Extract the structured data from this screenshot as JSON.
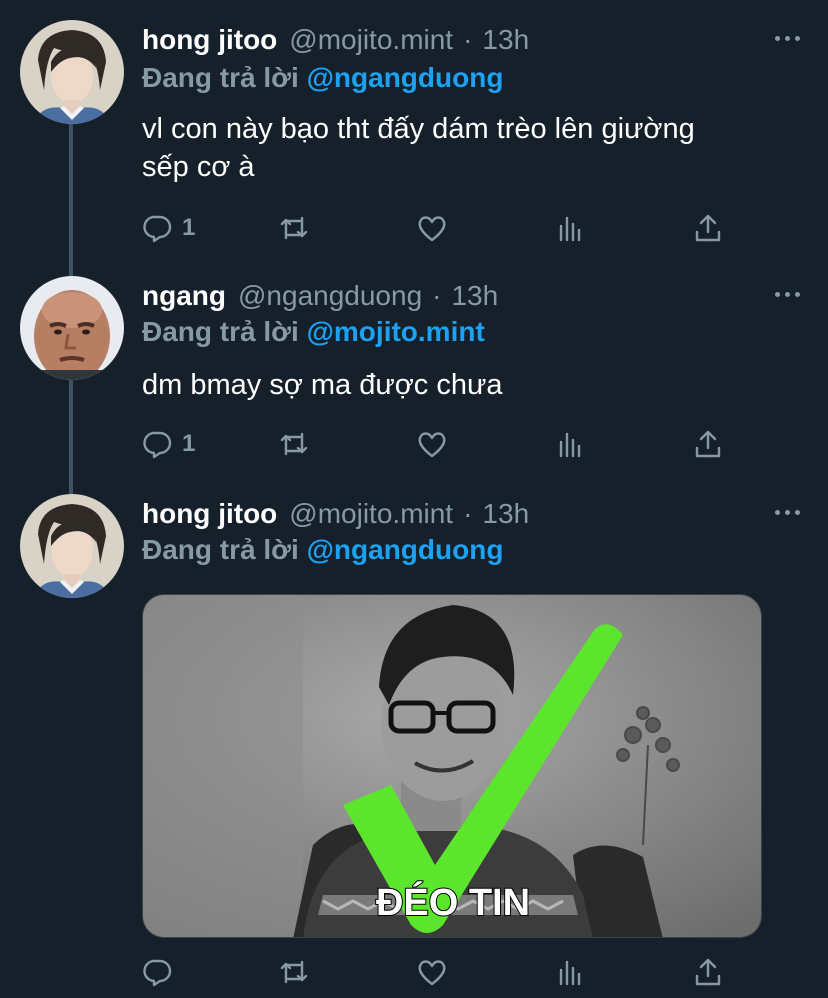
{
  "tweets": [
    {
      "name": "hong jitoo",
      "handle": "@mojito.mint",
      "time": "13h",
      "reply_prefix": "Đang trả lời",
      "reply_to": "@ngangduong",
      "text_lines": [
        "vl con này bạo tht đấy dám trèo lên giường",
        "sếp cơ à"
      ],
      "reply_count": "1"
    },
    {
      "name": "ngang",
      "handle": "@ngangduong",
      "time": "13h",
      "reply_prefix": "Đang trả lời",
      "reply_to": "@mojito.mint",
      "text_lines": [
        "dm bmay sợ ma được chưa"
      ],
      "reply_count": "1"
    },
    {
      "name": "hong jitoo",
      "handle": "@mojito.mint",
      "time": "13h",
      "reply_prefix": "Đang trả lời",
      "reply_to": "@ngangduong",
      "media_caption": "ĐÉO TIN",
      "reply_count": ""
    }
  ],
  "separator": "·",
  "icons": [
    "reply-icon",
    "retweet-icon",
    "like-icon",
    "analytics-icon",
    "share-icon",
    "more-icon"
  ],
  "colors": {
    "background": "#15202b",
    "muted": "#8899a6",
    "accent": "#1da1f2",
    "check": "#5be52c"
  }
}
